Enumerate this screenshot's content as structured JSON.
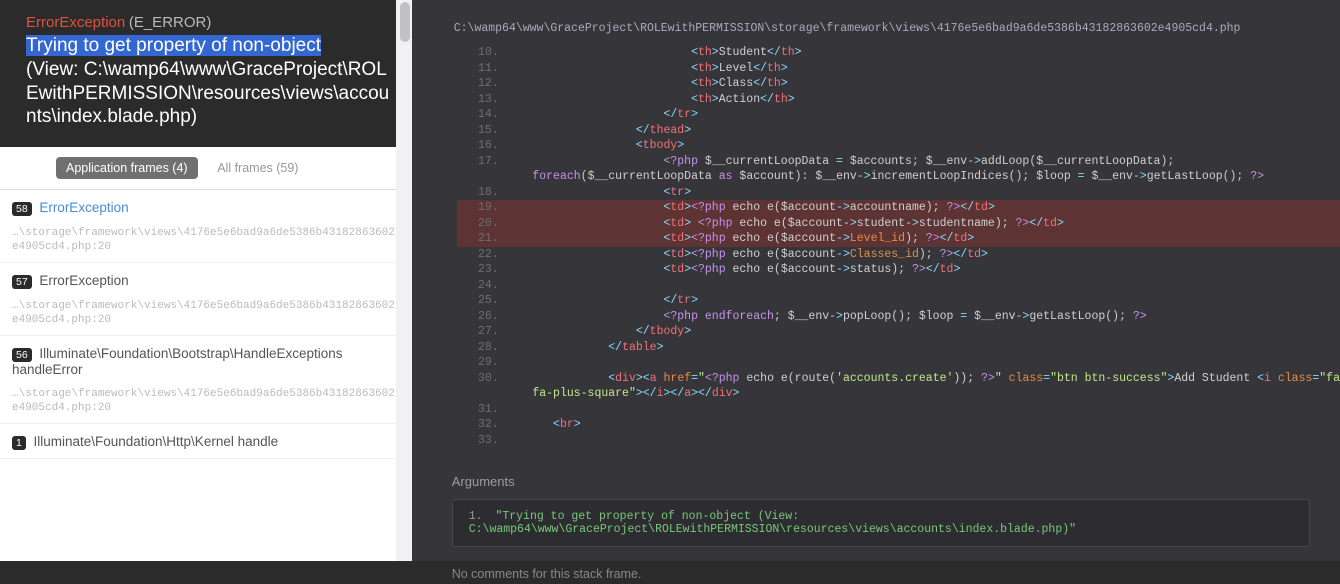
{
  "header": {
    "error_name": "ErrorException",
    "error_type": "(E_ERROR)",
    "message_highlight": "Trying to get property of non-object",
    "message_rest": "(View: C:\\wamp64\\www\\GraceProject\\ROLEwithPERMISSION\\resources\\views\\accounts\\index.blade.php)"
  },
  "tabs": {
    "active": "Application frames (4)",
    "inactive": "All frames (59)"
  },
  "frames": [
    {
      "num": "58",
      "title": "ErrorException",
      "color": "blue",
      "path": "…\\storage\\framework\\views\\4176e5e6bad9a6de5386b43182863602e4905cd4.php:20"
    },
    {
      "num": "57",
      "title": "ErrorException",
      "color": "gray",
      "path": "…\\storage\\framework\\views\\4176e5e6bad9a6de5386b43182863602e4905cd4.php:20"
    },
    {
      "num": "56",
      "title": "Illuminate\\Foundation\\Bootstrap\\HandleExceptions handleError",
      "color": "gray",
      "path": "…\\storage\\framework\\views\\4176e5e6bad9a6de5386b43182863602e4905cd4.php:20"
    },
    {
      "num": "1",
      "title": "Illuminate\\Foundation\\Http\\Kernel handle",
      "color": "gray",
      "path": ""
    }
  ],
  "file_path": "C:\\wamp64\\www\\GraceProject\\ROLEwithPERMISSION\\storage\\framework\\views\\4176e5e6bad9a6de5386b43182863602e4905cd4.php",
  "code": [
    {
      "n": 10,
      "hl": false,
      "html": "                           <span class='t-op'>&lt;</span><span class='t-tag'>th</span><span class='t-op'>&gt;</span><span class='t-txt'>Student</span><span class='t-op'>&lt;/</span><span class='t-tag'>th</span><span class='t-op'>&gt;</span>"
    },
    {
      "n": 11,
      "hl": false,
      "html": "                           <span class='t-op'>&lt;</span><span class='t-tag'>th</span><span class='t-op'>&gt;</span><span class='t-txt'>Level</span><span class='t-op'>&lt;/</span><span class='t-tag'>th</span><span class='t-op'>&gt;</span>"
    },
    {
      "n": 12,
      "hl": false,
      "html": "                           <span class='t-op'>&lt;</span><span class='t-tag'>th</span><span class='t-op'>&gt;</span><span class='t-txt'>Class</span><span class='t-op'>&lt;/</span><span class='t-tag'>th</span><span class='t-op'>&gt;</span>"
    },
    {
      "n": 13,
      "hl": false,
      "html": "                           <span class='t-op'>&lt;</span><span class='t-tag'>th</span><span class='t-op'>&gt;</span><span class='t-txt'>Action</span><span class='t-op'>&lt;/</span><span class='t-tag'>th</span><span class='t-op'>&gt;</span>"
    },
    {
      "n": 14,
      "hl": false,
      "html": "                       <span class='t-op'>&lt;/</span><span class='t-tag'>tr</span><span class='t-op'>&gt;</span>"
    },
    {
      "n": 15,
      "hl": false,
      "html": "                   <span class='t-op'>&lt;/</span><span class='t-tag'>thead</span><span class='t-op'>&gt;</span>"
    },
    {
      "n": 16,
      "hl": false,
      "html": "                   <span class='t-op'>&lt;</span><span class='t-tag'>tbody</span><span class='t-op'>&gt;</span>"
    },
    {
      "n": 17,
      "hl": false,
      "html": "                       <span class='t-kw'>&lt;?php</span> <span class='t-var'>$__currentLoopData</span> <span class='t-op'>=</span> <span class='t-var'>$accounts</span>; <span class='t-var'>$__env</span><span class='t-op'>-&gt;</span><span class='t-txt'>addLoop</span>(<span class='t-var'>$__currentLoopData</span>); <br>    <span class='t-kw'>foreach</span>(<span class='t-var'>$__currentLoopData</span> <span class='t-kw'>as</span> <span class='t-var'>$account</span>): <span class='t-var'>$__env</span><span class='t-op'>-&gt;</span><span class='t-txt'>incrementLoopIndices</span>(); <span class='t-var'>$loop</span> <span class='t-op'>=</span> <span class='t-var'>$__env</span><span class='t-op'>-&gt;</span><span class='t-txt'>getLastLoop</span>(); <span class='t-kw'>?&gt;</span>"
    },
    {
      "n": 18,
      "hl": false,
      "html": "                       <span class='t-op'>&lt;</span><span class='t-tag'>tr</span><span class='t-op'>&gt;</span>"
    },
    {
      "n": 19,
      "hl": true,
      "html": "                       <span class='t-op'>&lt;</span><span class='t-tag'>td</span><span class='t-op'>&gt;</span><span class='t-kw'>&lt;?php</span> <span class='t-txt'>echo e(</span><span class='t-var'>$account</span><span class='t-op'>-&gt;</span><span class='t-txt'>accountname</span><span class='t-txt'>);</span> <span class='t-kw'>?&gt;</span><span class='t-op'>&lt;/</span><span class='t-tag'>td</span><span class='t-op'>&gt;</span>"
    },
    {
      "n": 20,
      "hl": true,
      "html": "                       <span class='t-op'>&lt;</span><span class='t-tag'>td</span><span class='t-op'>&gt;</span> <span class='t-kw'>&lt;?php</span> <span class='t-txt'>echo e(</span><span class='t-var'>$account</span><span class='t-op'>-&gt;</span><span class='t-txt'>student</span><span class='t-op'>-&gt;</span><span class='t-txt'>studentname</span><span class='t-txt'>);</span> <span class='t-kw'>?&gt;</span><span class='t-op'>&lt;/</span><span class='t-tag'>td</span><span class='t-op'>&gt;</span>"
    },
    {
      "n": 21,
      "hl": true,
      "html": "                       <span class='t-op'>&lt;</span><span class='t-tag'>td</span><span class='t-op'>&gt;</span><span class='t-kw'>&lt;?php</span> <span class='t-txt'>echo e(</span><span class='t-var'>$account</span><span class='t-op'>-&gt;</span><span class='t-prop'>Level_id</span><span class='t-txt'>);</span> <span class='t-kw'>?&gt;</span><span class='t-op'>&lt;/</span><span class='t-tag'>td</span><span class='t-op'>&gt;</span>"
    },
    {
      "n": 22,
      "hl": false,
      "html": "                       <span class='t-op'>&lt;</span><span class='t-tag'>td</span><span class='t-op'>&gt;</span><span class='t-kw'>&lt;?php</span> <span class='t-txt'>echo e(</span><span class='t-var'>$account</span><span class='t-op'>-&gt;</span><span class='t-prop'>Classes_id</span><span class='t-txt'>);</span> <span class='t-kw'>?&gt;</span><span class='t-op'>&lt;/</span><span class='t-tag'>td</span><span class='t-op'>&gt;</span>"
    },
    {
      "n": 23,
      "hl": false,
      "html": "                       <span class='t-op'>&lt;</span><span class='t-tag'>td</span><span class='t-op'>&gt;</span><span class='t-kw'>&lt;?php</span> <span class='t-txt'>echo e(</span><span class='t-var'>$account</span><span class='t-op'>-&gt;</span><span class='t-txt'>status</span><span class='t-txt'>);</span> <span class='t-kw'>?&gt;</span><span class='t-op'>&lt;/</span><span class='t-tag'>td</span><span class='t-op'>&gt;</span>"
    },
    {
      "n": 24,
      "hl": false,
      "html": " "
    },
    {
      "n": 25,
      "hl": false,
      "html": "                       <span class='t-op'>&lt;/</span><span class='t-tag'>tr</span><span class='t-op'>&gt;</span>"
    },
    {
      "n": 26,
      "hl": false,
      "html": "                       <span class='t-kw'>&lt;?php</span> <span class='t-kw'>endforeach</span>; <span class='t-var'>$__env</span><span class='t-op'>-&gt;</span><span class='t-txt'>popLoop</span>(); <span class='t-var'>$loop</span> <span class='t-op'>=</span> <span class='t-var'>$__env</span><span class='t-op'>-&gt;</span><span class='t-txt'>getLastLoop</span>(); <span class='t-kw'>?&gt;</span>"
    },
    {
      "n": 27,
      "hl": false,
      "html": "                   <span class='t-op'>&lt;/</span><span class='t-tag'>tbody</span><span class='t-op'>&gt;</span>"
    },
    {
      "n": 28,
      "hl": false,
      "html": "               <span class='t-op'>&lt;/</span><span class='t-tag'>table</span><span class='t-op'>&gt;</span>"
    },
    {
      "n": 29,
      "hl": false,
      "html": " "
    },
    {
      "n": 30,
      "hl": false,
      "html": "               <span class='t-op'>&lt;</span><span class='t-tag'>div</span><span class='t-op'>&gt;&lt;</span><span class='t-tag'>a</span> <span class='t-attr'>href</span><span class='t-op'>=</span><span class='t-str'>\"</span><span class='t-kw'>&lt;?php</span> <span class='t-txt'>echo e(route(</span><span class='t-str'>'accounts.create'</span><span class='t-txt'>));</span> <span class='t-kw'>?&gt;</span><span class='t-str'>\"</span> <span class='t-attr'>class</span><span class='t-op'>=</span><span class='t-str'>\"btn btn-success\"</span><span class='t-op'>&gt;</span><span class='t-txt'>Add Student </span><span class='t-op'>&lt;</span><span class='t-tag'>i</span> <span class='t-attr'>class</span><span class='t-op'>=</span><span class='t-str'>\"fa<br>    fa-plus-square\"</span><span class='t-op'>&gt;&lt;/</span><span class='t-tag'>i</span><span class='t-op'>&gt;&lt;/</span><span class='t-tag'>a</span><span class='t-op'>&gt;&lt;/</span><span class='t-tag'>div</span><span class='t-op'>&gt;</span>"
    },
    {
      "n": 31,
      "hl": false,
      "html": " "
    },
    {
      "n": 32,
      "hl": false,
      "html": "       <span class='t-op'>&lt;</span><span class='t-tag'>br</span><span class='t-op'>&gt;</span>"
    },
    {
      "n": 33,
      "hl": false,
      "html": " "
    }
  ],
  "args": {
    "title": "Arguments",
    "num": "1.",
    "text": "\"Trying to get property of non-object (View: C:\\wamp64\\www\\GraceProject\\ROLEwithPERMISSION\\resources\\views\\accounts\\index.blade.php)\""
  },
  "comments": "No comments for this stack frame."
}
